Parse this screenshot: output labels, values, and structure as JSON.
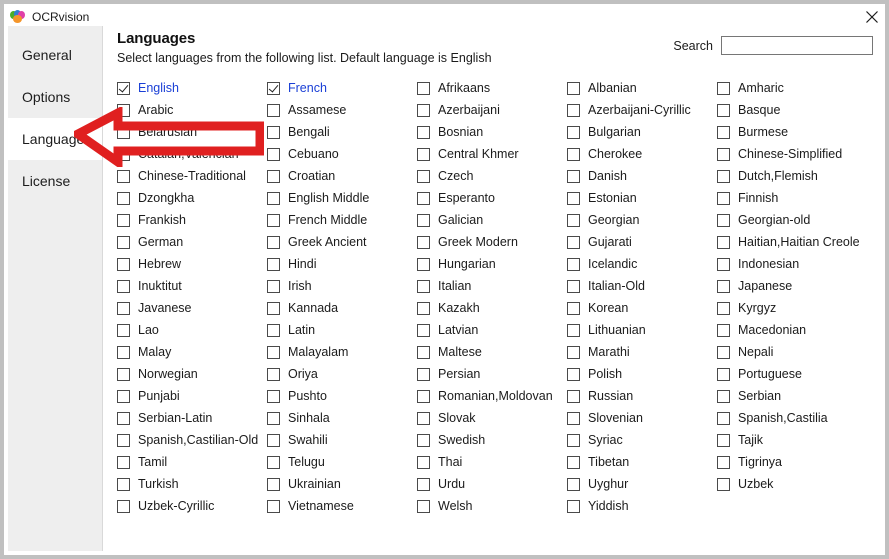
{
  "window": {
    "title": "OCRvision",
    "app_icon": "ocrvision-logo-icon",
    "close_icon": "close-icon"
  },
  "sidebar": {
    "items": [
      {
        "label": "General",
        "selected": false
      },
      {
        "label": "Options",
        "selected": false
      },
      {
        "label": "Languages",
        "selected": true
      },
      {
        "label": "License",
        "selected": false
      }
    ]
  },
  "main": {
    "title": "Languages",
    "subtitle": "Select languages from the following list. Default language is English",
    "search": {
      "label": "Search",
      "value": "",
      "placeholder": ""
    },
    "annotation": {
      "type": "arrow",
      "color": "#e02020",
      "points_to": "sidebar-item-languages"
    },
    "languages": [
      {
        "label": "English",
        "checked": true
      },
      {
        "label": "Arabic",
        "checked": false
      },
      {
        "label": "Belarusian",
        "checked": false
      },
      {
        "label": "Catalan,Valencian",
        "checked": false
      },
      {
        "label": "Chinese-Traditional",
        "checked": false
      },
      {
        "label": "Dzongkha",
        "checked": false
      },
      {
        "label": "Frankish",
        "checked": false
      },
      {
        "label": "German",
        "checked": false
      },
      {
        "label": "Hebrew",
        "checked": false
      },
      {
        "label": "Inuktitut",
        "checked": false
      },
      {
        "label": "Javanese",
        "checked": false
      },
      {
        "label": "Lao",
        "checked": false
      },
      {
        "label": "Malay",
        "checked": false
      },
      {
        "label": "Norwegian",
        "checked": false
      },
      {
        "label": "Punjabi",
        "checked": false
      },
      {
        "label": "Serbian-Latin",
        "checked": false
      },
      {
        "label": "Spanish,Castilian-Old",
        "checked": false
      },
      {
        "label": "Tamil",
        "checked": false
      },
      {
        "label": "Turkish",
        "checked": false
      },
      {
        "label": "Uzbek-Cyrillic",
        "checked": false
      },
      {
        "label": "French",
        "checked": true
      },
      {
        "label": "Assamese",
        "checked": false
      },
      {
        "label": "Bengali",
        "checked": false
      },
      {
        "label": "Cebuano",
        "checked": false
      },
      {
        "label": "Croatian",
        "checked": false
      },
      {
        "label": "English Middle",
        "checked": false
      },
      {
        "label": "French Middle",
        "checked": false
      },
      {
        "label": "Greek Ancient",
        "checked": false
      },
      {
        "label": "Hindi",
        "checked": false
      },
      {
        "label": "Irish",
        "checked": false
      },
      {
        "label": "Kannada",
        "checked": false
      },
      {
        "label": "Latin",
        "checked": false
      },
      {
        "label": "Malayalam",
        "checked": false
      },
      {
        "label": "Oriya",
        "checked": false
      },
      {
        "label": "Pushto",
        "checked": false
      },
      {
        "label": "Sinhala",
        "checked": false
      },
      {
        "label": "Swahili",
        "checked": false
      },
      {
        "label": "Telugu",
        "checked": false
      },
      {
        "label": "Ukrainian",
        "checked": false
      },
      {
        "label": "Vietnamese",
        "checked": false
      },
      {
        "label": "Afrikaans",
        "checked": false
      },
      {
        "label": "Azerbaijani",
        "checked": false
      },
      {
        "label": "Bosnian",
        "checked": false
      },
      {
        "label": "Central Khmer",
        "checked": false
      },
      {
        "label": "Czech",
        "checked": false
      },
      {
        "label": "Esperanto",
        "checked": false
      },
      {
        "label": "Galician",
        "checked": false
      },
      {
        "label": "Greek Modern",
        "checked": false
      },
      {
        "label": "Hungarian",
        "checked": false
      },
      {
        "label": "Italian",
        "checked": false
      },
      {
        "label": "Kazakh",
        "checked": false
      },
      {
        "label": "Latvian",
        "checked": false
      },
      {
        "label": "Maltese",
        "checked": false
      },
      {
        "label": "Persian",
        "checked": false
      },
      {
        "label": "Romanian,Moldovan",
        "checked": false
      },
      {
        "label": "Slovak",
        "checked": false
      },
      {
        "label": "Swedish",
        "checked": false
      },
      {
        "label": "Thai",
        "checked": false
      },
      {
        "label": "Urdu",
        "checked": false
      },
      {
        "label": "Welsh",
        "checked": false
      },
      {
        "label": "Albanian",
        "checked": false
      },
      {
        "label": "Azerbaijani-Cyrillic",
        "checked": false
      },
      {
        "label": "Bulgarian",
        "checked": false
      },
      {
        "label": "Cherokee",
        "checked": false
      },
      {
        "label": "Danish",
        "checked": false
      },
      {
        "label": "Estonian",
        "checked": false
      },
      {
        "label": "Georgian",
        "checked": false
      },
      {
        "label": "Gujarati",
        "checked": false
      },
      {
        "label": "Icelandic",
        "checked": false
      },
      {
        "label": "Italian-Old",
        "checked": false
      },
      {
        "label": "Korean",
        "checked": false
      },
      {
        "label": "Lithuanian",
        "checked": false
      },
      {
        "label": "Marathi",
        "checked": false
      },
      {
        "label": "Polish",
        "checked": false
      },
      {
        "label": "Russian",
        "checked": false
      },
      {
        "label": "Slovenian",
        "checked": false
      },
      {
        "label": "Syriac",
        "checked": false
      },
      {
        "label": "Tibetan",
        "checked": false
      },
      {
        "label": "Uyghur",
        "checked": false
      },
      {
        "label": "Yiddish",
        "checked": false
      },
      {
        "label": "Amharic",
        "checked": false
      },
      {
        "label": "Basque",
        "checked": false
      },
      {
        "label": "Burmese",
        "checked": false
      },
      {
        "label": "Chinese-Simplified",
        "checked": false
      },
      {
        "label": "Dutch,Flemish",
        "checked": false
      },
      {
        "label": "Finnish",
        "checked": false
      },
      {
        "label": "Georgian-old",
        "checked": false
      },
      {
        "label": "Haitian,Haitian Creole",
        "checked": false
      },
      {
        "label": "Indonesian",
        "checked": false
      },
      {
        "label": "Japanese",
        "checked": false
      },
      {
        "label": "Kyrgyz",
        "checked": false
      },
      {
        "label": "Macedonian",
        "checked": false
      },
      {
        "label": "Nepali",
        "checked": false
      },
      {
        "label": "Portuguese",
        "checked": false
      },
      {
        "label": "Serbian",
        "checked": false
      },
      {
        "label": "Spanish,Castilia",
        "checked": false
      },
      {
        "label": "Tajik",
        "checked": false
      },
      {
        "label": "Tigrinya",
        "checked": false
      },
      {
        "label": "Uzbek",
        "checked": false
      }
    ]
  }
}
